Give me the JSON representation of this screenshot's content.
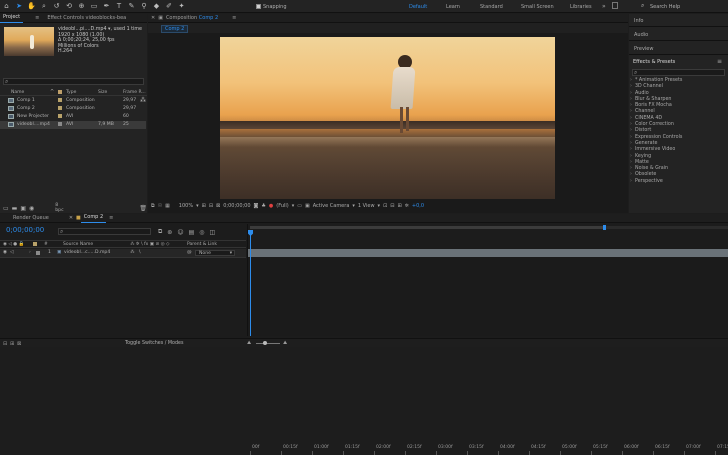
{
  "toolbar": {
    "tools": [
      "home-icon",
      "selection-icon",
      "hand-icon",
      "zoom-icon",
      "rotate-icon",
      "camera-orbit-icon",
      "pan-behind-icon",
      "rectangle-icon",
      "pen-icon",
      "type-icon",
      "brush-icon",
      "clone-stamp-icon",
      "eraser-icon",
      "roto-brush-icon",
      "puppet-pin-icon"
    ],
    "snapping_label": "Snapping",
    "workspaces": [
      "Default",
      "Learn",
      "Standard",
      "Small Screen",
      "Libraries"
    ],
    "active_workspace": "Default",
    "search_placeholder": "Search Help"
  },
  "project_panel": {
    "tab_project": "Project",
    "tab_effect_controls": "Effect Controls videoblocks-bea",
    "file_name": "videobl...pi....D.mp4 ▾",
    "used": ", used 1 time",
    "resolution": "1920 x 1080 (1.00)",
    "duration": "Δ 0;00;20;24, 25,00 fps",
    "colors": "Millions of Colors",
    "codec": "H.264",
    "search_placeholder": "",
    "columns": {
      "name": "Name",
      "type": "Type",
      "size": "Size",
      "fps": "Frame R..."
    },
    "items": [
      {
        "name": "Comp 1",
        "type": "Composition",
        "size": "",
        "fps": "29,97",
        "label_color": "#b8a26a",
        "kind": "comp",
        "selected": false
      },
      {
        "name": "Comp 2",
        "type": "Composition",
        "size": "",
        "fps": "29,97",
        "label_color": "#b8a26a",
        "kind": "comp",
        "selected": false
      },
      {
        "name": "New Projecter",
        "type": "AVI",
        "size": "",
        "fps": "60",
        "label_color": "#b8a26a",
        "kind": "avi",
        "selected": false
      },
      {
        "name": "videobl....mp4",
        "type": "AVI",
        "size": "7,9 MB",
        "fps": "25",
        "label_color": "#8a8a8a",
        "kind": "video",
        "selected": true
      }
    ],
    "bpc": "8 bpc"
  },
  "composition_panel": {
    "tab_title": "Composition",
    "tab_comp": "Comp 2",
    "sub_tab": "Comp 2",
    "zoom": "100%",
    "timecode": "0;00;00;00",
    "resolution": "(Full)",
    "camera": "Active Camera",
    "views": "1 View",
    "exposure": "+0,0"
  },
  "right_panels": {
    "info": "Info",
    "audio": "Audio",
    "preview": "Preview",
    "effects_title": "Effects & Presets",
    "effects": [
      "* Animation Presets",
      "3D Channel",
      "Audio",
      "Blur & Sharpen",
      "Boris FX Mocha",
      "Channel",
      "CINEMA 4D",
      "Color Correction",
      "Distort",
      "Expression Controls",
      "Generate",
      "Immersive Video",
      "Keying",
      "Matte",
      "Noise & Grain",
      "Obsolete",
      "Perspective"
    ]
  },
  "timeline": {
    "tab_render": "Render Queue",
    "tab_comp": "Comp 2",
    "timecode": "0;00;00;00",
    "search_placeholder": "",
    "col_source": "Source Name",
    "col_parent": "Parent & Link",
    "layer_num": "1",
    "layer_name": "videobl...c.....D.mp4",
    "parent_value": "None",
    "ruler": [
      "00f",
      "00:15f",
      "01:00f",
      "01:15f",
      "02:00f",
      "02:15f",
      "03:00f",
      "03:15f",
      "04:00f",
      "04:15f",
      "05:00f",
      "05:15f",
      "06:00f",
      "06:15f",
      "07:00f",
      "07:15f"
    ],
    "toggle_label": "Toggle Switches / Modes"
  },
  "colors": {
    "accent": "#2d8ceb",
    "layer_bar": "#6a7278"
  }
}
